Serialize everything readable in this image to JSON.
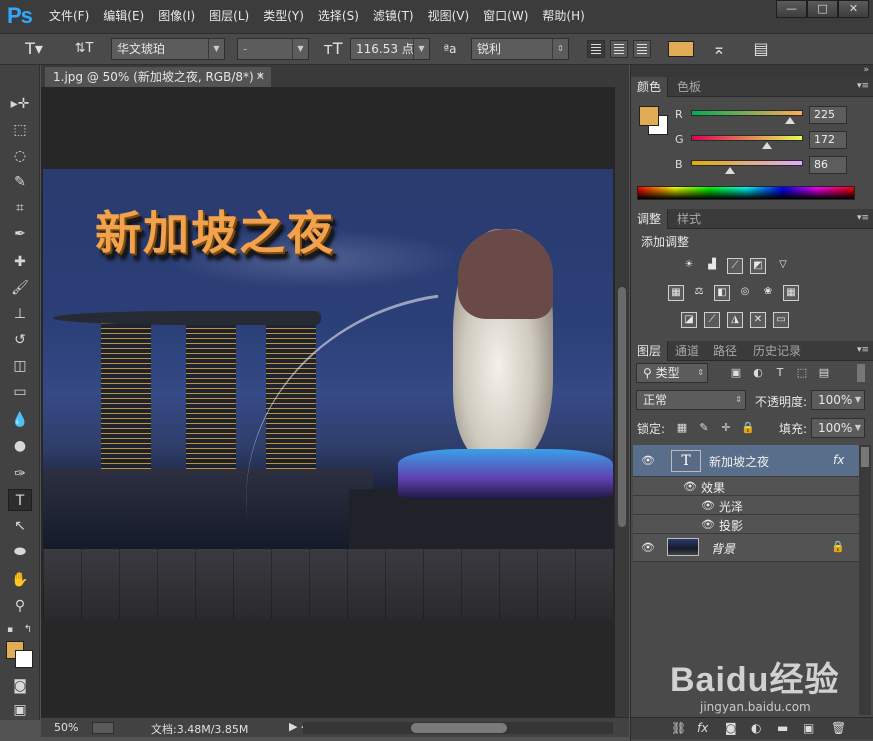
{
  "app": {
    "logo": "Ps"
  },
  "menu": [
    "文件(F)",
    "编辑(E)",
    "图像(I)",
    "图层(L)",
    "类型(Y)",
    "选择(S)",
    "滤镜(T)",
    "视图(V)",
    "窗口(W)",
    "帮助(H)"
  ],
  "window_controls": [
    "—",
    "□",
    "✕"
  ],
  "options": {
    "font_family": "华文琥珀",
    "font_style": "-",
    "font_size": "116.53 点",
    "antialias": "锐利",
    "text_color": "#e1ac56"
  },
  "document": {
    "tab_title": "1.jpg @ 50% (新加坡之夜, RGB/8*) *",
    "canvas_text": "新加坡之夜"
  },
  "status": {
    "zoom": "50%",
    "doc_size": "文档:3.48M/3.85M"
  },
  "color_panel": {
    "tabs": [
      "颜色",
      "色板"
    ],
    "foreground": "#e1ac56",
    "channels": [
      {
        "label": "R",
        "value": "225",
        "fraction": 0.882
      },
      {
        "label": "G",
        "value": "172",
        "fraction": 0.675
      },
      {
        "label": "B",
        "value": "86",
        "fraction": 0.337
      }
    ]
  },
  "adjustments_panel": {
    "tabs": [
      "调整",
      "样式"
    ],
    "title": "添加调整"
  },
  "layers_panel": {
    "tabs": [
      "图层",
      "通道",
      "路径",
      "历史记录"
    ],
    "filter": "类型",
    "blend_mode": "正常",
    "opacity_label": "不透明度:",
    "opacity": "100%",
    "lock_label": "锁定:",
    "fill_label": "填充:",
    "fill": "100%",
    "layers": [
      {
        "name": "新加坡之夜",
        "thumb": "T",
        "fx": "fx"
      },
      {
        "name": "背景"
      }
    ],
    "effects_label": "效果",
    "effects": [
      "光泽",
      "投影"
    ]
  },
  "watermark": {
    "text": "Baidu经验",
    "sub": "jingyan.baidu.com"
  }
}
